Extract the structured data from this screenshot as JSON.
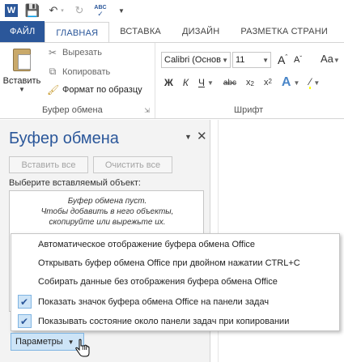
{
  "qat": {
    "app_logo": "W",
    "icons": [
      "word-logo",
      "save-icon",
      "undo-icon",
      "undo-dropdown-icon",
      "redo-icon",
      "spelling-icon",
      "customize-icon"
    ],
    "spelling_abc": "ABC"
  },
  "tabs": [
    "ФАЙЛ",
    "ГЛАВНАЯ",
    "ВСТАВКА",
    "ДИЗАЙН",
    "РАЗМЕТКА СТРАНИ"
  ],
  "ribbon": {
    "clipboard": {
      "paste_label": "Вставить",
      "cut_label": "Вырезать",
      "copy_label": "Копировать",
      "format_painter_label": "Формат по образцу",
      "group_label": "Буфер обмена"
    },
    "font": {
      "font_name": "Calibri (Основ",
      "font_size": "11",
      "grow_shrink_label": "Aa",
      "bold": "Ж",
      "italic": "К",
      "underline": "Ч",
      "strikethrough": "abc",
      "subscript": "x",
      "superscript": "x",
      "group_label": "Шрифт"
    }
  },
  "pane": {
    "title": "Буфер обмена",
    "paste_all": "Вставить все",
    "clear_all": "Очистить все",
    "prompt": "Выберите вставляемый объект:",
    "empty_message": [
      "Буфер обмена пуст.",
      "Чтобы добавить в него объекты,",
      "скопируйте или вырежьте их."
    ]
  },
  "options_menu": {
    "items": [
      {
        "label": "Автоматическое отображение буфера обмена Office",
        "checked": false
      },
      {
        "label": "Открывать буфер обмена Office при двойном нажатии CTRL+C",
        "checked": false
      },
      {
        "label": "Собирать данные без отображения буфера обмена Office",
        "checked": false
      },
      {
        "label": "Показать значок буфера обмена Office на панели задач",
        "checked": true
      },
      {
        "label": "Показывать состояние около панели задач при копировании",
        "checked": true
      }
    ]
  },
  "options_button": {
    "label": "Параметры"
  },
  "colors": {
    "accent": "#2b579a",
    "selection": "#cde4f7",
    "selection_border": "#7fb4e2",
    "pane_bg": "#f3f3f3",
    "highlight_yellow": "#ffff00"
  }
}
